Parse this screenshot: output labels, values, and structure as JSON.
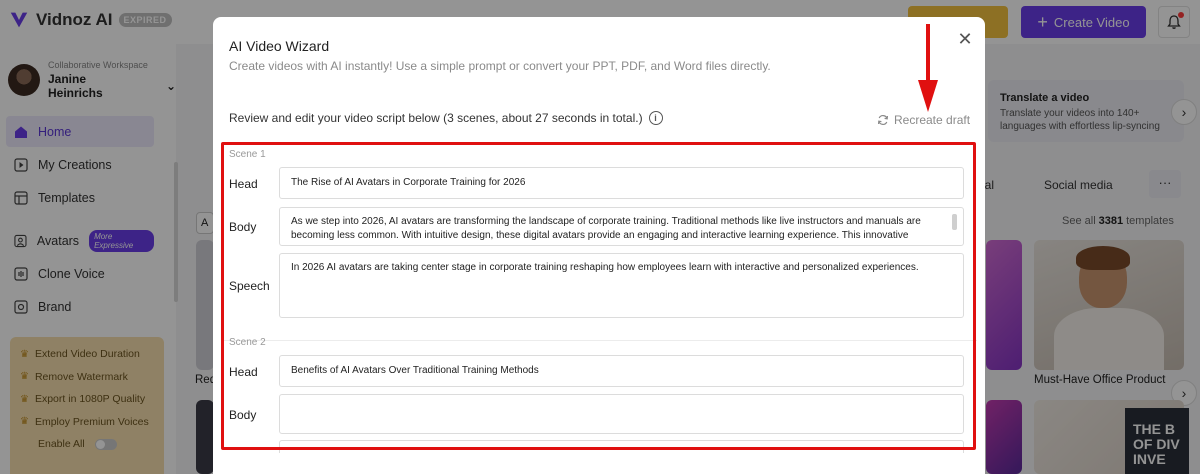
{
  "app": {
    "logo_text": "Vidnoz AI",
    "badge": "EXPIRED",
    "create_video_label": "Create Video"
  },
  "sidebar": {
    "workspace_label": "Collaborative Workspace",
    "user_name": "Janine Heinrichs",
    "items": [
      {
        "label": "Home",
        "icon": "home-icon",
        "active": true
      },
      {
        "label": "My Creations",
        "icon": "play-square-icon"
      },
      {
        "label": "Templates",
        "icon": "template-icon"
      },
      {
        "label": "Avatars",
        "icon": "avatar-icon",
        "tag": "More Expressive"
      },
      {
        "label": "Clone Voice",
        "icon": "voice-icon"
      },
      {
        "label": "Brand",
        "icon": "brand-icon"
      }
    ],
    "upgrade_items": [
      "Extend Video Duration",
      "Remove Watermark",
      "Export in 1080P Quality",
      "Employ Premium Voices"
    ],
    "enable_all_label": "Enable All"
  },
  "main": {
    "translate_card": {
      "title": "Translate a video",
      "desc_line1": "Translate your videos into 140+",
      "desc_line2": "languages with effortless lip-syncing"
    },
    "categories": {
      "s_partial": "S",
      "social_partial": "ial",
      "social_media": "Social media",
      "more": "···"
    },
    "see_all": {
      "prefix": "See all",
      "count": "3381",
      "suffix": "templates"
    },
    "template_caption_right": "Must-Have Office Product",
    "template_caption_left": "Red",
    "chip_partial": "A",
    "dark_thumb_text": "THE B OF DIV INVE"
  },
  "modal": {
    "title": "AI Video Wizard",
    "subtitle": "Create videos with AI instantly! Use a simple prompt or convert your PPT, PDF, and Word files directly.",
    "review_text": "Review and edit your video script below (3 scenes, about 27 seconds in total.)",
    "recreate_label": "Recreate draft",
    "labels": {
      "head": "Head",
      "body": "Body",
      "speech": "Speech"
    },
    "scenes": [
      {
        "label": "Scene 1",
        "head": "The Rise of AI Avatars in Corporate Training for 2026",
        "body": "As we step into 2026, AI avatars are transforming the landscape of corporate training. Traditional methods like live instructors and manuals are becoming less common. With intuitive design, these digital avatars provide an engaging and interactive learning experience. This innovative approach not only",
        "speech": "In 2026 AI avatars are taking center stage in corporate training reshaping how employees learn with interactive and personalized experiences."
      },
      {
        "label": "Scene 2",
        "head": "Benefits of AI Avatars Over Traditional Training Methods",
        "body": ""
      }
    ]
  },
  "colors": {
    "accent": "#6a3de8",
    "highlight": "#e01010",
    "upgrade_bg": "#f6dfae"
  }
}
